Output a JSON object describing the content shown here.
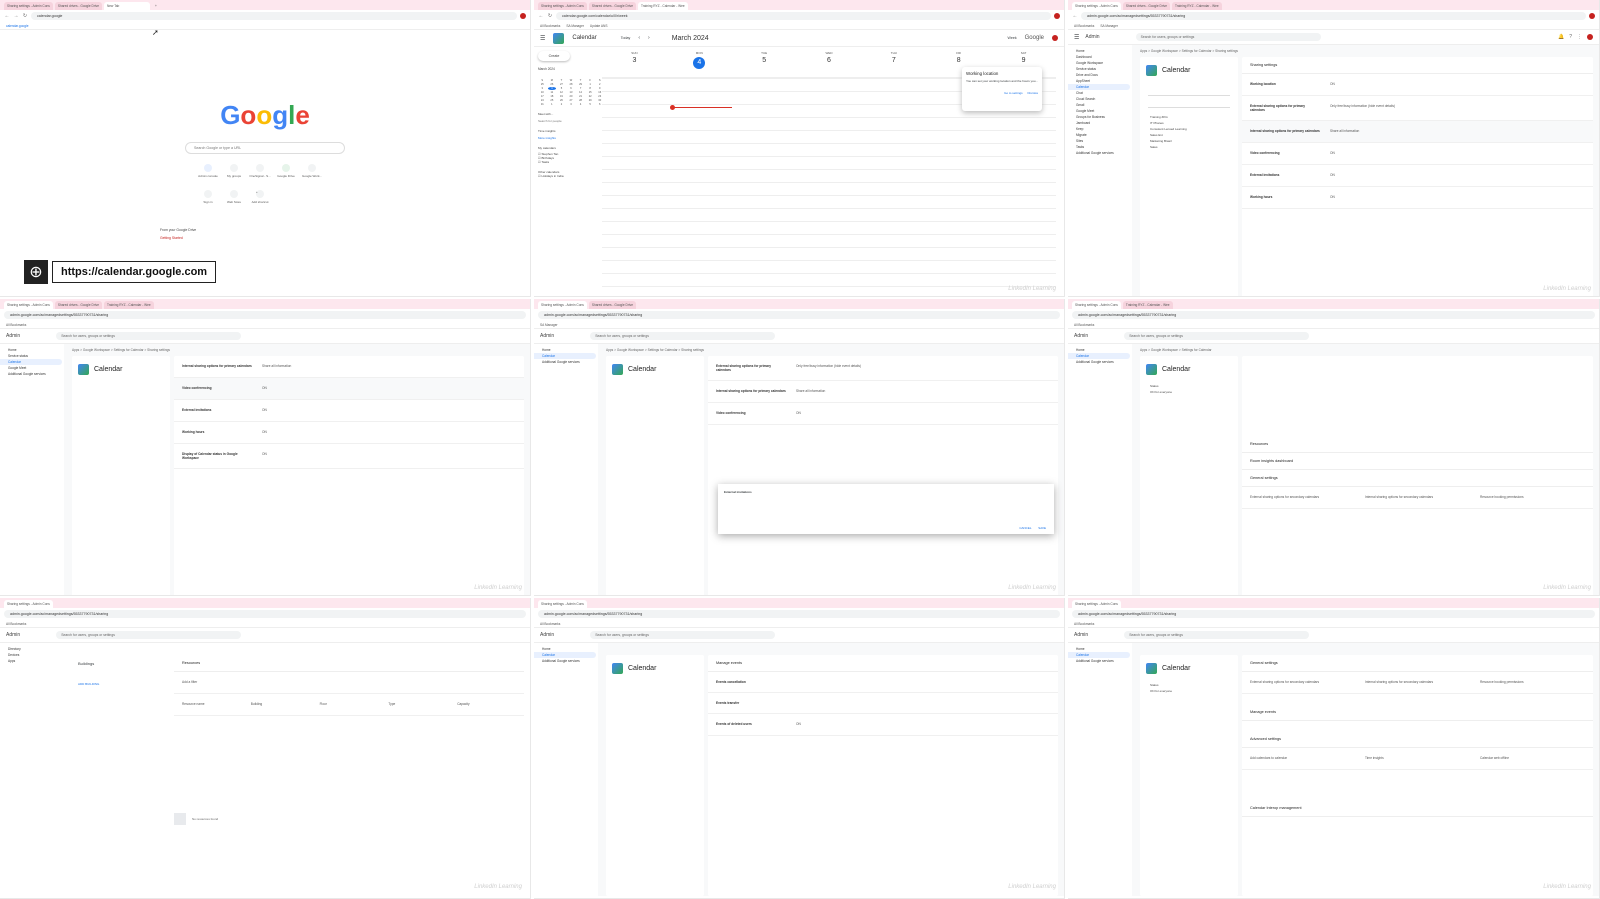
{
  "browser": {
    "tabs_admin": [
      "Sharing settings - Admin Cons",
      "Shared drives - Google Drive",
      "Training RYZ - Calendar - Wee"
    ],
    "tabs_home": [
      "Sharing settings - Admin Cons",
      "Shared drives - Google Drive",
      "New Tab"
    ],
    "tab_new": "New Tab",
    "omnibox_typed": "calendar.google",
    "omnibox_suggestion": "calendar.google",
    "omnibox_admin": "admin.google.com/ac/managedsettings/55337790731/sharing",
    "omnibox_calendar": "calendar.google.com/calendar/u/0/r/week",
    "bookmarks": [
      "All Bookmarks",
      "SA Manager",
      "Update ANS"
    ]
  },
  "home": {
    "logo": "Google",
    "search_placeholder": "Search Google or type a URL",
    "shortcuts": [
      "Admin console",
      "My groups",
      "OneSignal - S...",
      "Google Drive",
      "Google Work...",
      "Sign in",
      "Web Store",
      "Add shortcut"
    ],
    "drive_title": "From your Google Drive",
    "drive_item": "Getting Started",
    "url_badge": "https://calendar.google.com"
  },
  "calendar": {
    "app_name": "Calendar",
    "today": "Today",
    "month": "March 2024",
    "view": "Week",
    "create": "Create",
    "mini_month": "March 2024",
    "mini_days": [
      "S",
      "M",
      "T",
      "W",
      "T",
      "F",
      "S",
      "25",
      "26",
      "27",
      "28",
      "29",
      "1",
      "2",
      "3",
      "4",
      "5",
      "6",
      "7",
      "8",
      "9",
      "10",
      "11",
      "12",
      "13",
      "14",
      "15",
      "16",
      "17",
      "18",
      "19",
      "20",
      "21",
      "22",
      "23",
      "24",
      "25",
      "26",
      "27",
      "28",
      "29",
      "30",
      "31",
      "1",
      "2",
      "3",
      "4",
      "5",
      "6"
    ],
    "days": [
      {
        "d": "SUN",
        "n": "3"
      },
      {
        "d": "MON",
        "n": "4"
      },
      {
        "d": "TUE",
        "n": "5"
      },
      {
        "d": "WED",
        "n": "6"
      },
      {
        "d": "THU",
        "n": "7"
      },
      {
        "d": "FRI",
        "n": "8"
      },
      {
        "d": "SAT",
        "n": "9"
      }
    ],
    "meet_with": "Meet with...",
    "search_people": "Search for people",
    "time_insights": "Time insights",
    "more_insights": "More insights",
    "my_calendars": "My calendars",
    "calendars": [
      "Stephen Tan",
      "Birthdays",
      "Tasks"
    ],
    "other_calendars": "Other calendars",
    "other_list": [
      "Holidays in India"
    ],
    "popup_title": "Working location",
    "popup_body": "You can set your working location and the hours you...",
    "popup_actions": [
      "Go to settings",
      "Dismiss"
    ],
    "brand": "Google"
  },
  "admin": {
    "app": "Admin",
    "search_placeholder": "Search for users, groups or settings",
    "sidebar": [
      "Home",
      "Dashboard",
      "Directory",
      "Devices",
      "Apps",
      "Google Workspace",
      "Service status",
      "Drive and Docs",
      "Gmail",
      "AppSheet",
      "Calendar",
      "Chat",
      "Cloud Search",
      "Google Meet",
      "Groups for Business",
      "Jamboard",
      "Keep",
      "Migrate",
      "Sites",
      "Tasks",
      "Additional Google services"
    ],
    "service": "Calendar",
    "crumb": "Apps > Google Workspace > Settings for Calendar > Sharing settings",
    "crumb_short": "Apps > Google Workspace > Settings for Calendar",
    "ou_list": [
      "Training ZKG",
      "IT Phanes",
      "Consolent Lensed Learning",
      "Sales Ext",
      "Marketing Brasil",
      "Sales"
    ],
    "status": "Status",
    "status_val": "ON for everyone",
    "card_title": "Sharing settings",
    "rows": [
      {
        "label": "Working location",
        "value": "ON"
      },
      {
        "label": "External sharing options for primary calendars",
        "value": "Only free/busy information (hide event details)"
      },
      {
        "label": "Internal sharing options for primary calendars",
        "value": "Share all information"
      },
      {
        "label": "Video conferencing",
        "value": "ON"
      },
      {
        "label": "External invitations",
        "value": "ON"
      },
      {
        "label": "Working hours",
        "value": "ON"
      },
      {
        "label": "Display of Calendar status in Google Workspace",
        "value": "ON"
      }
    ],
    "sections": [
      "Resources",
      "Room insights dashboard",
      "General settings",
      "Manage events",
      "Advanced settings",
      "Calendar Interop management"
    ],
    "general_cols": [
      "External sharing options for secondary calendars",
      "Internal sharing options for secondary calendars",
      "Resource booking permissions"
    ],
    "advanced_cols": [
      "Add calendars to calendar",
      "Time insights",
      "Calendar web offline"
    ],
    "manage_events_rows": [
      {
        "label": "Events cancellation",
        "value": ""
      },
      {
        "label": "Events transfer",
        "value": ""
      },
      {
        "label": "Events of deleted users",
        "value": "ON"
      }
    ],
    "dialog_title": "External invitations",
    "dialog_actions": [
      "CANCEL",
      "SAVE"
    ],
    "resources_title": "Resources",
    "buildings": "Buildings",
    "resources_empty": "No resources found",
    "add_building": "ADD BUILDING",
    "resource_cols": [
      "Resource name",
      "Building",
      "Floor",
      "Type",
      "Capacity"
    ],
    "add_filter": "Add a filter"
  },
  "watermark": "LinkedIn Learning"
}
